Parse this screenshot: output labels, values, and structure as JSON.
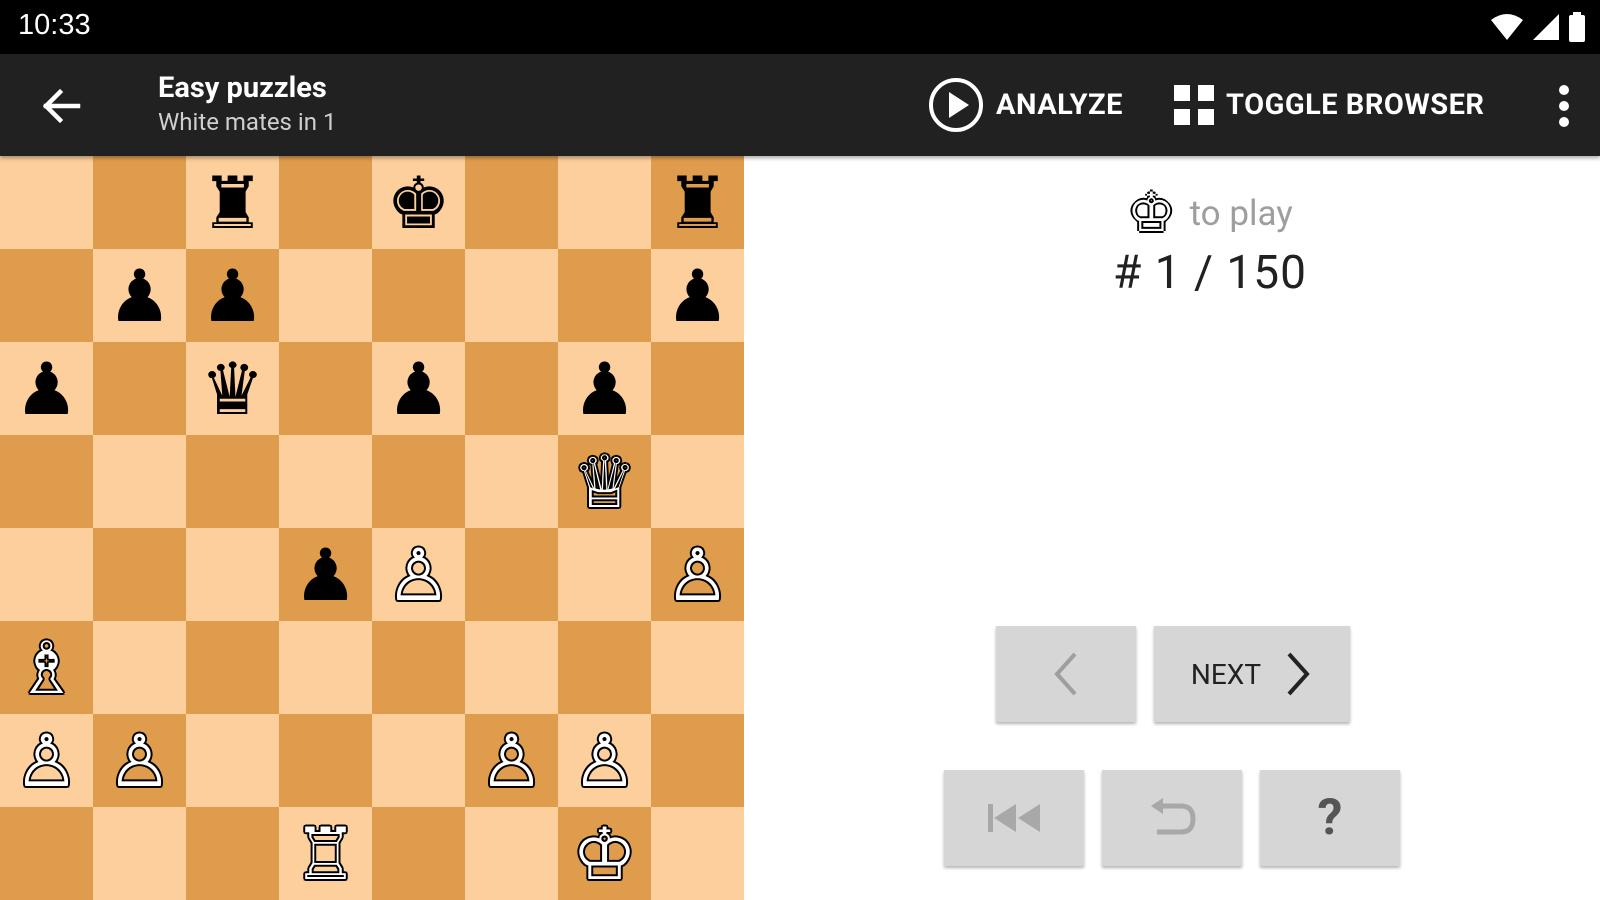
{
  "status_bar": {
    "time": "10:33"
  },
  "app_bar": {
    "title": "Easy puzzles",
    "subtitle": "White mates in 1",
    "analyze_label": "ANALYZE",
    "toggle_browser_label": "TOGGLE BROWSER"
  },
  "board": {
    "light_color": "#fdcf9c",
    "dark_color": "#e09c4d",
    "ranks": [
      [
        "",
        "",
        "♜",
        "",
        "♚",
        "",
        "",
        "♜"
      ],
      [
        "",
        "♟",
        "♟",
        "",
        "",
        "",
        "",
        "♟"
      ],
      [
        "♟",
        "",
        "♛",
        "",
        "♟",
        "",
        "♟",
        ""
      ],
      [
        "",
        "",
        "",
        "",
        "",
        "",
        "♕",
        ""
      ],
      [
        "",
        "",
        "",
        "♟",
        "♙",
        "",
        "",
        "♙"
      ],
      [
        "♗",
        "",
        "",
        "",
        "",
        "",
        "",
        ""
      ],
      [
        "♙",
        "♙",
        "",
        "",
        "",
        "♙",
        "♙",
        ""
      ],
      [
        "",
        "",
        "",
        "♖",
        "",
        "",
        "♔",
        ""
      ]
    ]
  },
  "puzzle_info": {
    "to_play_label": "to play",
    "side_to_move": "white",
    "counter": "# 1 / 150"
  },
  "controls": {
    "next_label": "NEXT",
    "hint_label": "?"
  }
}
